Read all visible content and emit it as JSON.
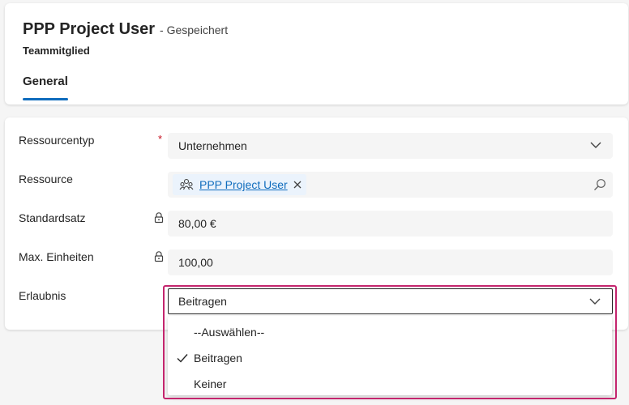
{
  "header": {
    "title": "PPP Project User",
    "saved_status": "- Gespeichert",
    "subtitle": "Teammitglied",
    "tabs": [
      {
        "label": "General",
        "active": true
      }
    ]
  },
  "form": {
    "fields": [
      {
        "label": "Ressourcentyp",
        "required": true,
        "required_mark": "*",
        "value": "Unternehmen",
        "type": "select"
      },
      {
        "label": "Ressource",
        "type": "lookup",
        "value": "PPP Project User"
      },
      {
        "label": "Standardsatz",
        "locked": true,
        "value": "80,00 €",
        "type": "text"
      },
      {
        "label": "Max. Einheiten",
        "locked": true,
        "value": "100,00",
        "type": "text"
      },
      {
        "label": "Erlaubnis",
        "type": "select",
        "value": "Beitragen",
        "open": true
      }
    ]
  },
  "dropdown": {
    "options": [
      {
        "label": "--Auswählen--",
        "selected": false
      },
      {
        "label": "Beitragen",
        "selected": true
      },
      {
        "label": "Keiner",
        "selected": false
      }
    ]
  },
  "colors": {
    "accent": "#0f6cbd",
    "required": "#c50f1f",
    "highlight": "#c4256e",
    "chip_bg": "#ebf3fc"
  },
  "icons": {
    "dropdown": "chevron-down-icon",
    "lookup_search": "search-icon",
    "lock": "lock-icon",
    "chip": "team-icon",
    "chip_remove": "close-icon",
    "selected": "checkmark-icon"
  }
}
